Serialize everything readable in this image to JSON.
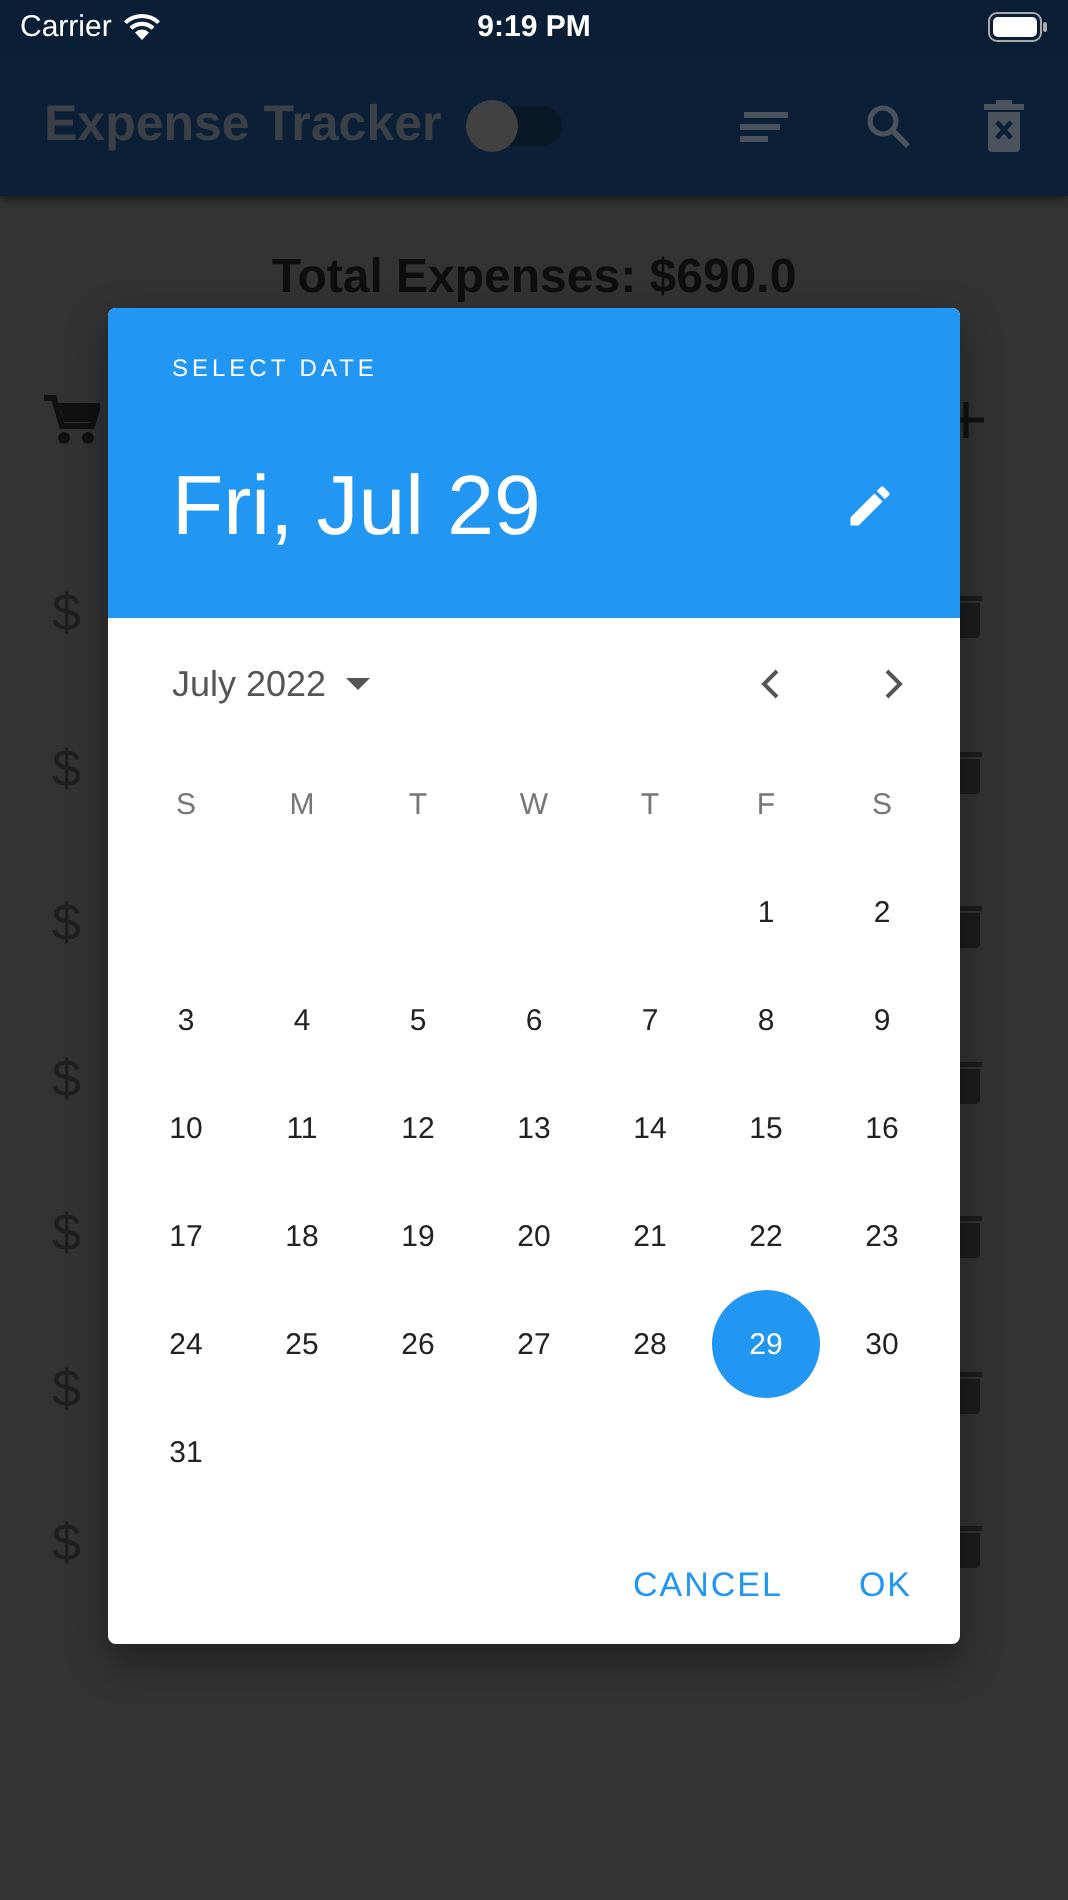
{
  "status_bar": {
    "carrier": "Carrier",
    "time": "9:19 PM"
  },
  "app_bar": {
    "title": "Expense Tracker",
    "toggle_on": false
  },
  "total": "Total Expenses: $690.0",
  "expenses": [
    {
      "icon": "$"
    },
    {
      "icon": "$"
    },
    {
      "icon": "$"
    },
    {
      "icon": "$"
    },
    {
      "icon": "$"
    },
    {
      "icon": "$"
    },
    {
      "icon": "$"
    }
  ],
  "date_picker": {
    "heading": "SELECT DATE",
    "selected_date": "Fri, Jul 29",
    "month": "July 2022",
    "weekdays": [
      "S",
      "M",
      "T",
      "W",
      "T",
      "F",
      "S"
    ],
    "weeks": [
      {
        "kind": "first",
        "days": [
          {
            "label": "1",
            "selected": false
          },
          {
            "label": "2",
            "selected": false
          }
        ]
      },
      {
        "kind": "full",
        "days": [
          {
            "label": "3",
            "selected": false
          },
          {
            "label": "4",
            "selected": false
          },
          {
            "label": "5",
            "selected": false
          },
          {
            "label": "6",
            "selected": false
          },
          {
            "label": "7",
            "selected": false
          },
          {
            "label": "8",
            "selected": false
          },
          {
            "label": "9",
            "selected": false
          }
        ]
      },
      {
        "kind": "full",
        "days": [
          {
            "label": "10",
            "selected": false
          },
          {
            "label": "11",
            "selected": false
          },
          {
            "label": "12",
            "selected": false
          },
          {
            "label": "13",
            "selected": false
          },
          {
            "label": "14",
            "selected": false
          },
          {
            "label": "15",
            "selected": false
          },
          {
            "label": "16",
            "selected": false
          }
        ]
      },
      {
        "kind": "full",
        "days": [
          {
            "label": "17",
            "selected": false
          },
          {
            "label": "18",
            "selected": false
          },
          {
            "label": "19",
            "selected": false
          },
          {
            "label": "20",
            "selected": false
          },
          {
            "label": "21",
            "selected": false
          },
          {
            "label": "22",
            "selected": false
          },
          {
            "label": "23",
            "selected": false
          }
        ]
      },
      {
        "kind": "full",
        "days": [
          {
            "label": "24",
            "selected": false
          },
          {
            "label": "25",
            "selected": false
          },
          {
            "label": "26",
            "selected": false
          },
          {
            "label": "27",
            "selected": false
          },
          {
            "label": "28",
            "selected": false
          },
          {
            "label": "29",
            "selected": true
          },
          {
            "label": "30",
            "selected": false
          }
        ]
      },
      {
        "kind": "last",
        "days": [
          {
            "label": "31",
            "selected": false
          }
        ]
      }
    ],
    "buttons": [
      "CANCEL",
      "OK"
    ]
  }
}
